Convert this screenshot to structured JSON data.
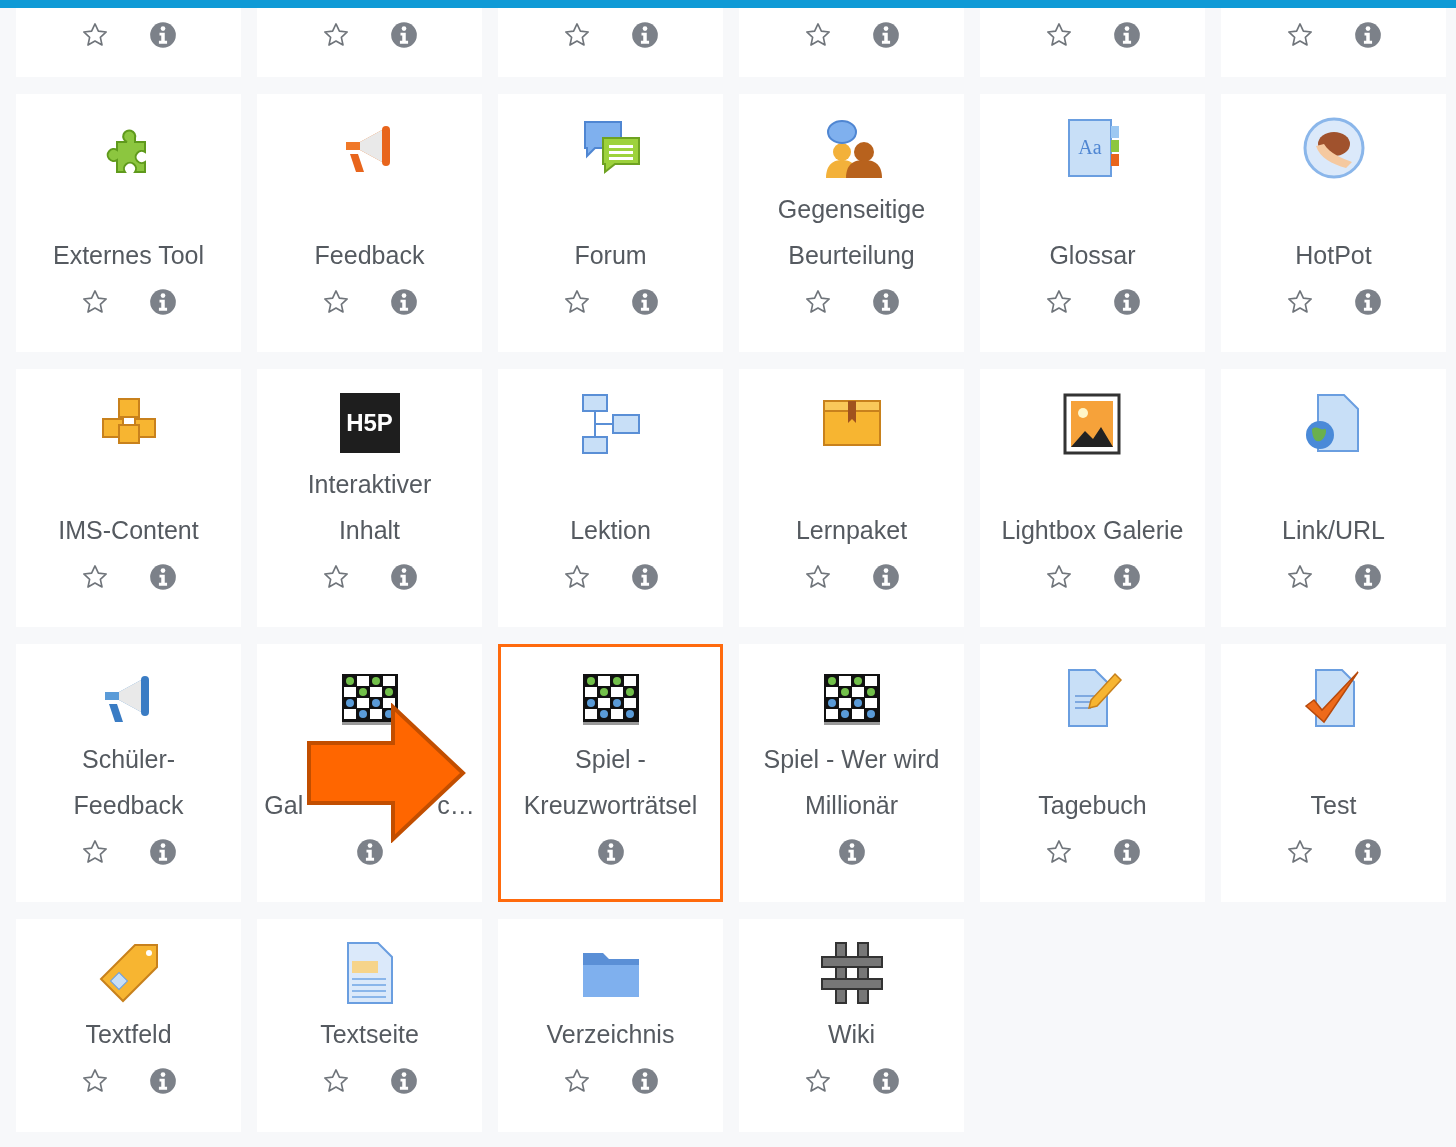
{
  "rows": [
    {
      "tiles": [
        {
          "star": true,
          "highlighted": false
        },
        {
          "star": true,
          "highlighted": false
        },
        {
          "star": true,
          "highlighted": false
        },
        {
          "star": true,
          "highlighted": false
        },
        {
          "star": true,
          "highlighted": false
        },
        {
          "star": true,
          "highlighted": false
        }
      ]
    },
    {
      "tiles": [
        {
          "name": "Externes Tool",
          "star": true,
          "highlighted": false
        },
        {
          "name": "Feedback",
          "star": true,
          "highlighted": false
        },
        {
          "name": "Forum",
          "star": true,
          "highlighted": false
        },
        {
          "name": "Gegenseitige Beurteilung",
          "star": true,
          "highlighted": false
        },
        {
          "name": "Glossar",
          "logo_text": "Aa",
          "star": true,
          "highlighted": false
        },
        {
          "name": "HotPot",
          "star": true,
          "highlighted": false
        }
      ]
    },
    {
      "tiles": [
        {
          "name": "IMS-Content",
          "star": true,
          "highlighted": false
        },
        {
          "name": "Interaktiver Inhalt",
          "logo_text": "H5P",
          "star": true,
          "highlighted": false
        },
        {
          "name": "Lektion",
          "star": true,
          "highlighted": false
        },
        {
          "name": "Lernpaket",
          "star": true,
          "highlighted": false
        },
        {
          "name": "Lightbox Galerie",
          "star": true,
          "highlighted": false
        },
        {
          "name": "Link/URL",
          "star": true,
          "highlighted": false
        }
      ]
    },
    {
      "tiles": [
        {
          "name": "Schüler-Feedback",
          "star": true,
          "highlighted": false
        },
        {
          "name": "Gal",
          "name_end": "c…",
          "star": false,
          "highlighted": false
        },
        {
          "name": "Spiel - Kreuzworträtsel",
          "star": false,
          "highlighted": true
        },
        {
          "name": "Spiel - Wer wird Millionär",
          "star": false,
          "highlighted": false
        },
        {
          "name": "Tagebuch",
          "star": true,
          "highlighted": false
        },
        {
          "name": "Test",
          "star": true,
          "highlighted": false
        }
      ]
    },
    {
      "tiles": [
        {
          "name": "Textfeld",
          "star": true,
          "highlighted": false
        },
        {
          "name": "Textseite",
          "star": true,
          "highlighted": false
        },
        {
          "name": "Verzeichnis",
          "star": true,
          "highlighted": false
        },
        {
          "name": "Wiki",
          "star": true,
          "highlighted": false
        }
      ]
    }
  ],
  "annotation": {
    "kind": "arrow"
  }
}
